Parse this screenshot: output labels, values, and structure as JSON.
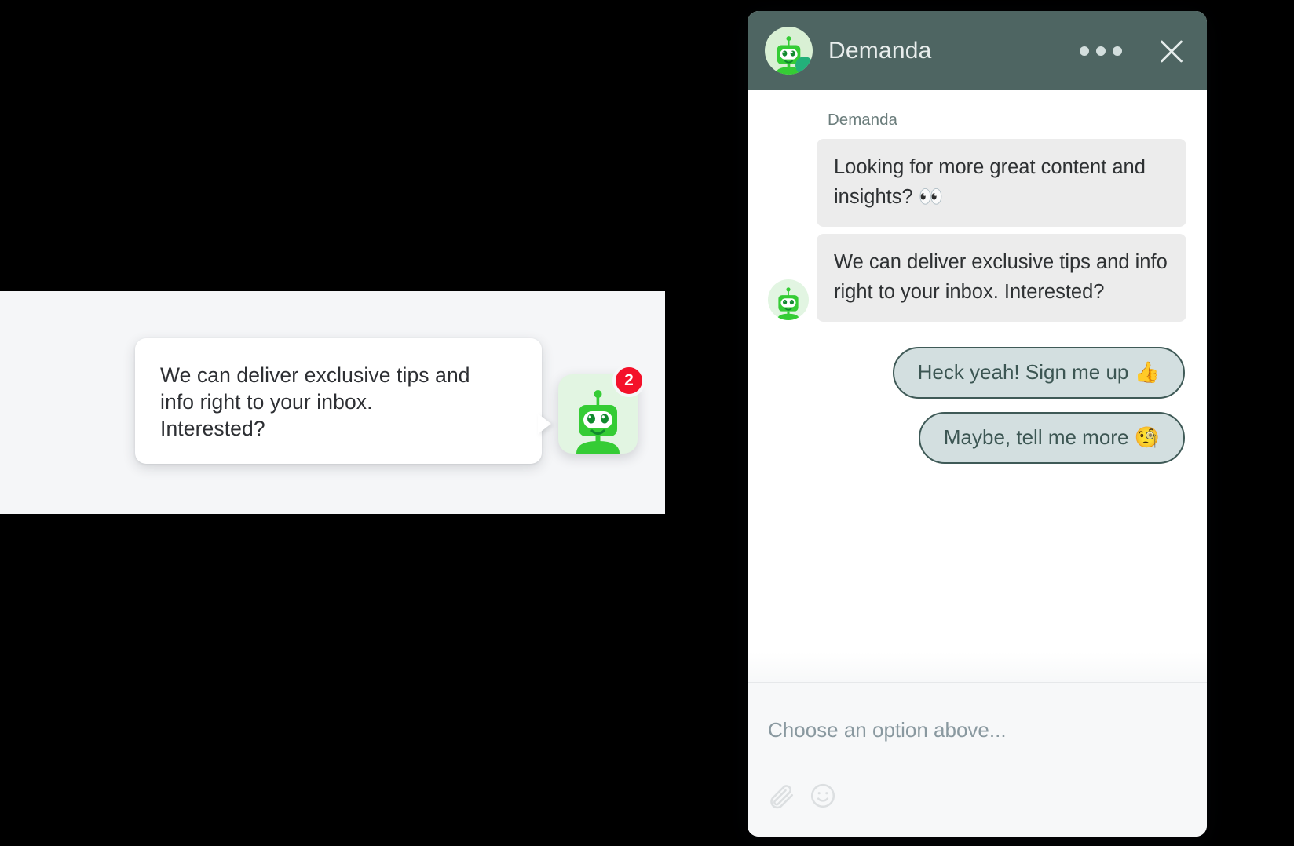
{
  "colors": {
    "header_bg": "#4e6562",
    "brand_green": "#35cc35",
    "avatar_bg": "#e2f5e2",
    "badge_red": "#f4112a",
    "online_dot": "#23b07a",
    "bot_bubble": "#ececec",
    "option_fill": "#d3dfe0",
    "option_border": "#3f5a57",
    "composer_bg": "#f7f8f9",
    "preview_strip_bg": "#f5f6f8",
    "page_bg": "#000000"
  },
  "preview": {
    "greeting_message": "We can deliver exclusive tips and\ninfo right to your inbox.\nInterested?",
    "launcher_badge_count": "2",
    "launcher_icon": "robot-avatar-icon",
    "badge_name": "unread-count-badge"
  },
  "chat": {
    "header": {
      "title": "Demanda",
      "avatar_icon": "robot-avatar-icon",
      "online_status_icon": "online-status-dot",
      "menu_icon": "ellipsis-horizontal-icon",
      "close_icon": "close-icon"
    },
    "sender_label": "Demanda",
    "messages": [
      {
        "id": "msg-1",
        "from": "bot",
        "text": "Looking for more great content and insights? 👀",
        "show_avatar": false
      },
      {
        "id": "msg-2",
        "from": "bot",
        "text": "We can deliver exclusive tips and info right to your inbox. Interested?",
        "show_avatar": true
      }
    ],
    "quick_replies": [
      {
        "id": "option-1",
        "label": "Heck yeah! Sign me up 👍"
      },
      {
        "id": "option-2",
        "label": "Maybe, tell me more 🧐"
      }
    ],
    "composer": {
      "placeholder": "Choose an option above...",
      "value": "",
      "attach_icon": "paperclip-icon",
      "emoji_icon": "smiley-face-icon"
    }
  }
}
